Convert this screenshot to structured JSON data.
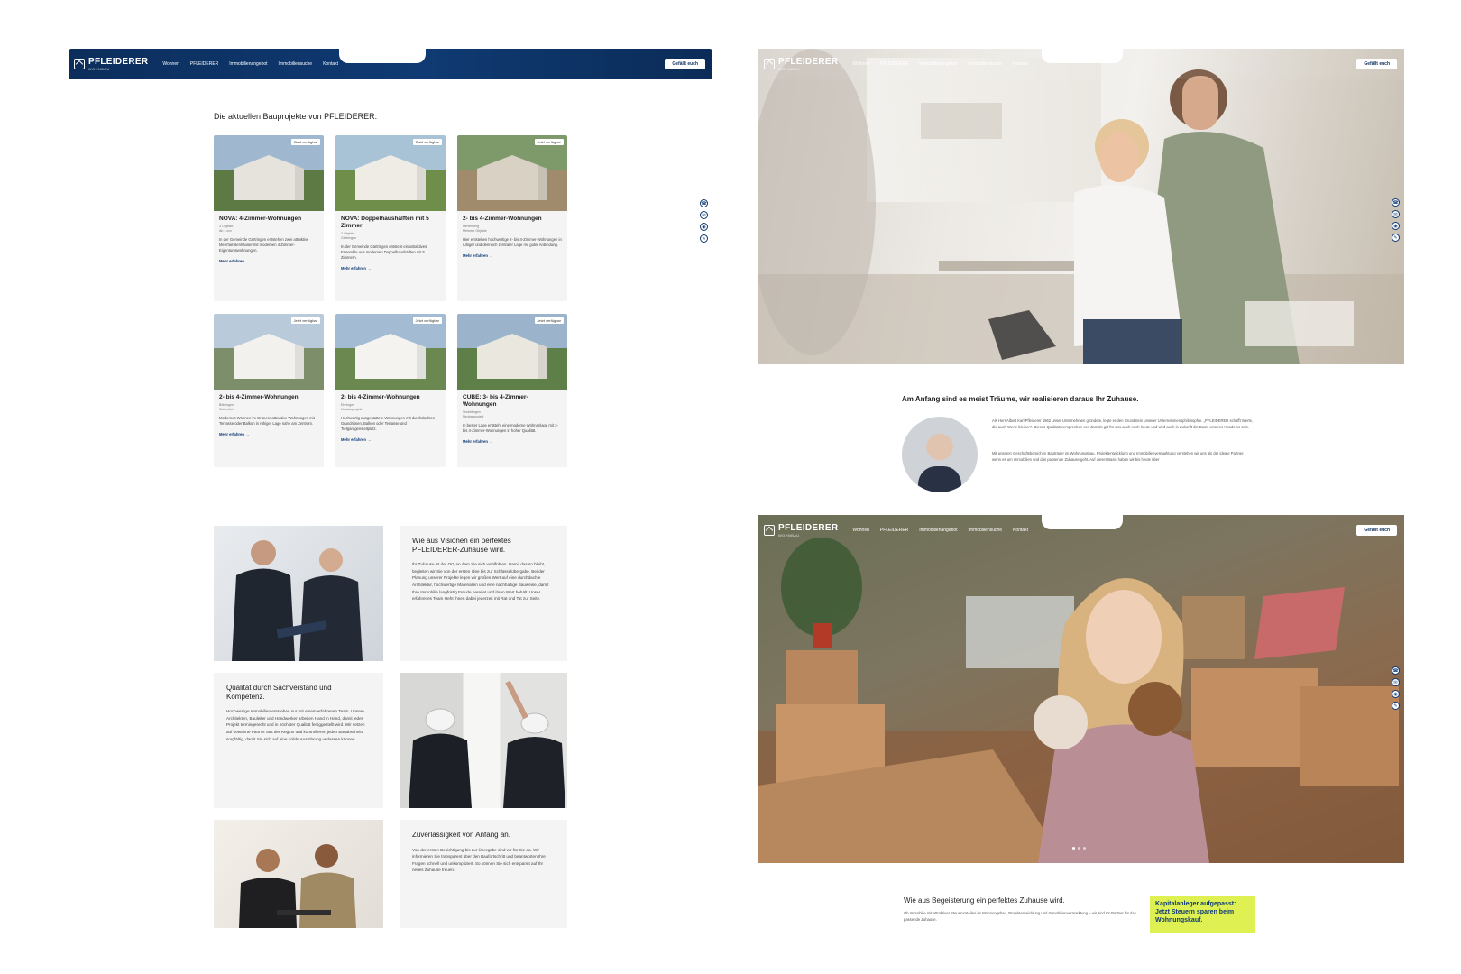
{
  "brand": {
    "name": "PFLEIDERER",
    "tagline": "WOHNBAU"
  },
  "nav": {
    "items": [
      "Wohnen",
      "PFLEIDERER",
      "Immobilienangebot",
      "Immobiliensuche",
      "Kontakt"
    ],
    "contact_label": "Gefällt euch"
  },
  "projects": {
    "heading": "Die aktuellen Bauprojekte von PFLEIDERER.",
    "cards": [
      {
        "tag": "Bald verfügbar",
        "title": "NOVA: 4-Zimmer-Wohnungen",
        "meta": "3 Objekte\nAb 1.xxx",
        "desc": "In der Gemeinde Gärtringen entstehen zwei attraktive Mehrfamilienhäuser mit modernen 4-Zimmer-Eigentumswohnungen.",
        "more": "Mehr erfahren"
      },
      {
        "tag": "Bald verfügbar",
        "title": "NOVA: Doppelhaushälften mit 5 Zimmer",
        "meta": "2 Objekte\nGärtringen",
        "desc": "In der Gemeinde Gärtringen entsteht ein attraktives Ensemble aus modernen Doppelhaushälften mit 5 Zimmern.",
        "more": "Mehr erfahren"
      },
      {
        "tag": "Jetzt verfügbar",
        "title": "2- bis 4-Zimmer-Wohnungen",
        "meta": "Herrenberg\nMehrere Objekte",
        "desc": "Hier entstehen hochwertige 2- bis 4-Zimmer-Wohnungen in ruhiger und dennoch zentraler Lage mit guter Anbindung.",
        "more": "Mehr erfahren"
      },
      {
        "tag": "Jetzt verfügbar",
        "title": "2- bis 4-Zimmer-Wohnungen",
        "meta": "Böblingen\nSeitenlicht",
        "desc": "Modernes Wohnen im Grünen: attraktive Wohnungen mit Terrasse oder Balkon in ruhiger Lage nahe am Zentrum.",
        "more": "Mehr erfahren"
      },
      {
        "tag": "Jetzt verfügbar",
        "title": "2- bis 4-Zimmer-Wohnungen",
        "meta": "Ehningen\nNeubauprojekt",
        "desc": "Hochwertig ausgestattete Wohnungen mit durchdachten Grundrissen, Balkon oder Terrasse und Tiefgaragenstellplatz.",
        "more": "Mehr erfahren"
      },
      {
        "tag": "Jetzt verfügbar",
        "title": "CUBE: 3- bis 4-Zimmer-Wohnungen",
        "meta": "Sindelfingen\nNeubauprojekt",
        "desc": "In bester Lage entsteht eine moderne Wohnanlage mit 3- bis 4-Zimmer-Wohnungen in hoher Qualität.",
        "more": "Mehr erfahren"
      }
    ]
  },
  "side_icons": [
    "phone-icon",
    "mail-icon",
    "whatsapp-icon",
    "chat-icon"
  ],
  "about": {
    "heading": "Am Anfang sind es meist Träume, wir realisieren daraus Ihr Zuhause.",
    "para1": "Als Herr Albert Karl Pfleiderer 1962 unser Unternehmen gründete, legte er den Grundstein unserer Unternehmensphilosophie. „PFLEIDERER schafft Werte, die auch Werte bleiben“. Dieses Qualitätsversprechen von damals gilt für uns auch noch heute und wird auch in Zukunft die Basis unseres Handelns sein.",
    "para2": "Mit unseren Geschäftsbereichen Bauträger im Wohnungsbau, Projektentwicklung und Immobilienvermarktung verstehen wir uns als der ideale Partner, wenn es um Immobilien und das passende Zuhause geht. Auf dieser Basis haben wir bis heute über"
  },
  "quality": [
    {
      "title": "Wie aus Visionen ein perfektes PFLEIDERER-Zuhause wird.",
      "body": "Ihr Zuhause ist der Ort, an dem Sie sich wohlfühlen. Damit das so bleibt, begleiten wir Sie von der ersten Idee bis zur Schlüsselübergabe. Bei der Planung unserer Projekte legen wir großen Wert auf eine durchdachte Architektur, hochwertige Materialien und eine nachhaltige Bauweise, damit Ihre Immobilie langfristig Freude bereitet und ihren Wert behält. Unser erfahrenes Team steht Ihnen dabei jederzeit mit Rat und Tat zur Seite."
    },
    {
      "title": "Qualität durch Sachverstand und Kompetenz.",
      "body": "Hochwertige Immobilien entstehen nur mit einem erfahrenen Team. Unsere Architekten, Bauleiter und Handwerker arbeiten Hand in Hand, damit jedes Projekt termingerecht und in höchster Qualität fertiggestellt wird. Wir setzen auf bewährte Partner aus der Region und kontrollieren jeden Bauabschnitt sorgfältig, damit Sie sich auf eine solide Ausführung verlassen können."
    },
    {
      "title": "Zuverlässigkeit von Anfang an.",
      "body": "Von der ersten Besichtigung bis zur Übergabe sind wir für Sie da. Wir informieren Sie transparent über den Baufortschritt und beantworten Ihre Fragen schnell und unkompliziert. So können Sie sich entspannt auf Ihr neues Zuhause freuen."
    }
  ],
  "hero2": {
    "heading": "Wie aus Begeisterung ein perfektes Zuhause wird.",
    "para": "Ob Immobilie mit attraktiver Steuervorteilen im Wohnungsbau, Projektentwicklung und Immobilienvermarktung – wir sind Ihr Partner für das passende Zuhause.",
    "promo": "Kapitalanleger aufgepasst: Jetzt Steuern sparen beim Wohnungskauf."
  }
}
